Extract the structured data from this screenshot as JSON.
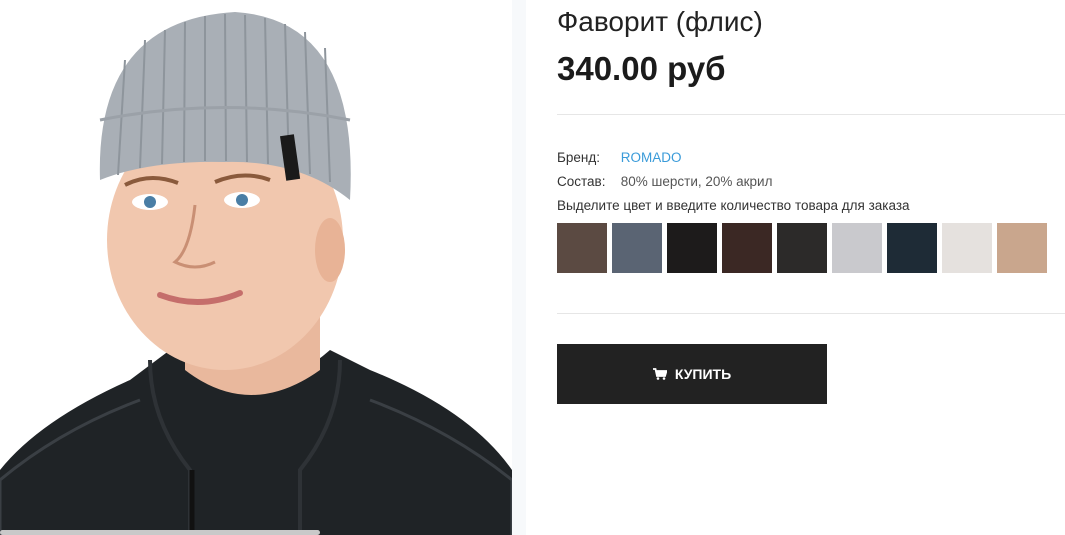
{
  "product": {
    "title": "Фаворит (флис)",
    "price": "340.00 руб",
    "image_alt": "Вязаная шапка серого цвета на модели"
  },
  "specs": {
    "brand_label": "Бренд:",
    "brand_value": "ROMADO",
    "composition_label": "Состав:",
    "composition_value": "80% шерсти, 20% акрил"
  },
  "color_hint": "Выделите цвет и введите количество товара для заказа",
  "swatches": [
    {
      "name": "dark-brown",
      "color": "#5b4a42"
    },
    {
      "name": "steel-blue",
      "color": "#5a6473"
    },
    {
      "name": "black",
      "color": "#1d1b1b"
    },
    {
      "name": "chocolate",
      "color": "#3b2824"
    },
    {
      "name": "charcoal",
      "color": "#2c2a29"
    },
    {
      "name": "light-grey",
      "color": "#c9c9cd"
    },
    {
      "name": "navy",
      "color": "#1e2b36"
    },
    {
      "name": "off-white",
      "color": "#e5e1de"
    },
    {
      "name": "beige",
      "color": "#c9a68d"
    }
  ],
  "buy_button": {
    "label": "КУПИТЬ",
    "icon": "cart-icon"
  },
  "colors": {
    "accent_link": "#3a9bd9",
    "button_bg": "#222222",
    "button_text": "#ffffff"
  }
}
